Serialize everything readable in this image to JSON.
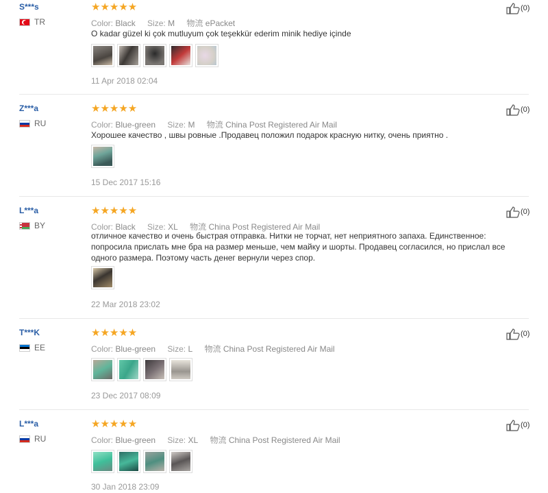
{
  "labels": {
    "color": "Color:",
    "size": "Size:",
    "shipping": "物流"
  },
  "reviews": [
    {
      "user": "S***s",
      "country": "TR",
      "stars": "★★★★★",
      "color": "Black",
      "size": "M",
      "shipping": "ePacket",
      "text": "O kadar güzel ki çok mutluyum çok teşekkür ederim minik hediye içinde",
      "date": "11 Apr 2018 02:04",
      "helpful": "(0)",
      "thumbs": [
        "#5a5551",
        "#6b6560",
        "#3d3c3b",
        "#4a4548",
        "#d9d4cc"
      ]
    },
    {
      "user": "Z***a",
      "country": "RU",
      "stars": "★★★★★",
      "color": "Blue-green",
      "size": "M",
      "shipping": "China Post Registered Air Mail",
      "text": "Хорошее качество , швы ровные .Продавец положил подарок красную нитку, очень приятно .",
      "date": "15 Dec 2017 15:16",
      "helpful": "(0)",
      "thumbs": [
        "#7aa59c"
      ]
    },
    {
      "user": "L***a",
      "country": "BY",
      "stars": "★★★★★",
      "color": "Black",
      "size": "XL",
      "shipping": "China Post Registered Air Mail",
      "text": "отличное качество и очень быстрая отправка. Нитки не торчат, нет неприятного запаха. Единственное: попросила прислать мне бра на размер меньше, чем майку и шорты. Продавец согласился, но прислал все одного размера. Поэтому часть денег вернули через спор.",
      "date": "22 Mar 2018 23:02",
      "helpful": "(0)",
      "thumbs": [
        "#8b7a5e"
      ]
    },
    {
      "user": "T***K",
      "country": "EE",
      "stars": "★★★★★",
      "color": "Blue-green",
      "size": "L",
      "shipping": "China Post Registered Air Mail",
      "text": "",
      "date": "23 Dec 2017 08:09",
      "helpful": "(0)",
      "thumbs": [
        "#7f8d84",
        "#5fc0a5",
        "#5d5556",
        "#b9b6b0"
      ]
    },
    {
      "user": "L***a",
      "country": "RU",
      "stars": "★★★★★",
      "color": "Blue-green",
      "size": "XL",
      "shipping": "China Post Registered Air Mail",
      "text": "",
      "date": "30 Jan 2018 23:09",
      "helpful": "(0)",
      "thumbs": [
        "#4fbf9f",
        "#3aa88e",
        "#6e8f86",
        "#8d8a88"
      ]
    }
  ]
}
